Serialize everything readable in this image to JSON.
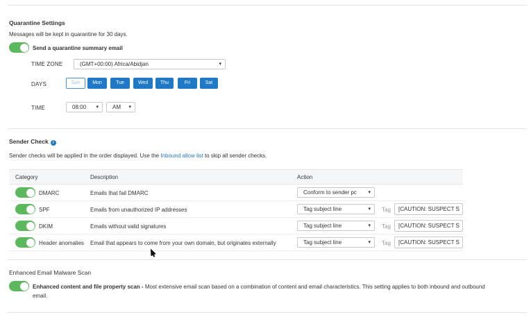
{
  "quarantine": {
    "heading": "Quarantine Settings",
    "description": "Messages will be kept in quarantine for 30 days.",
    "summary_toggle_label": "Send a quarantine summary email",
    "timezone_label": "TIME ZONE",
    "timezone_value": "(GMT+00:00) Africa/Abidjan",
    "days_label": "DAYS",
    "days": [
      {
        "label": "Sun",
        "selected": false
      },
      {
        "label": "Mon",
        "selected": true
      },
      {
        "label": "Tue",
        "selected": true
      },
      {
        "label": "Wed",
        "selected": true
      },
      {
        "label": "Thu",
        "selected": true
      },
      {
        "label": "Fri",
        "selected": true
      },
      {
        "label": "Sat",
        "selected": true
      }
    ],
    "time_label": "TIME",
    "time_value": "08:00",
    "ampm_value": "AM"
  },
  "sender_check": {
    "heading": "Sender Check",
    "description_before": "Sender checks will be applied in the order displayed. Use the ",
    "description_link": "Inbound allow list",
    "description_after": " to skip all sender checks.",
    "columns": {
      "category": "Category",
      "description": "Description",
      "action": "Action"
    },
    "rows": [
      {
        "category": "DMARC",
        "description": "Emails that fail DMARC",
        "action": "Conform to sender pc",
        "tag_label": "",
        "tag_value": ""
      },
      {
        "category": "SPF",
        "description": "Emails from unauthorized IP addresses",
        "action": "Tag subject line",
        "tag_label": "Tag",
        "tag_value": "[CAUTION: SUSPECT S"
      },
      {
        "category": "DKIM",
        "description": "Emails without valid signatures",
        "action": "Tag subject line",
        "tag_label": "Tag",
        "tag_value": "[CAUTION: SUSPECT S"
      },
      {
        "category": "Header anomalies",
        "description": "Email that appears to come from your own domain, but originates externally",
        "action": "Tag subject line",
        "tag_label": "Tag",
        "tag_value": "[CAUTION: SUSPECT S"
      }
    ]
  },
  "malware": {
    "heading": "Enhanced Email Malware Scan",
    "toggle_title": "Enhanced content and file property scan - ",
    "toggle_text_line1": "Most extensive email scan based on a combination of content and email characteristics. This setting applies to both inbound and outbound",
    "toggle_text_line2": "email."
  },
  "colors": {
    "toggle_on": "#5cb85c",
    "accent": "#2079c7"
  }
}
